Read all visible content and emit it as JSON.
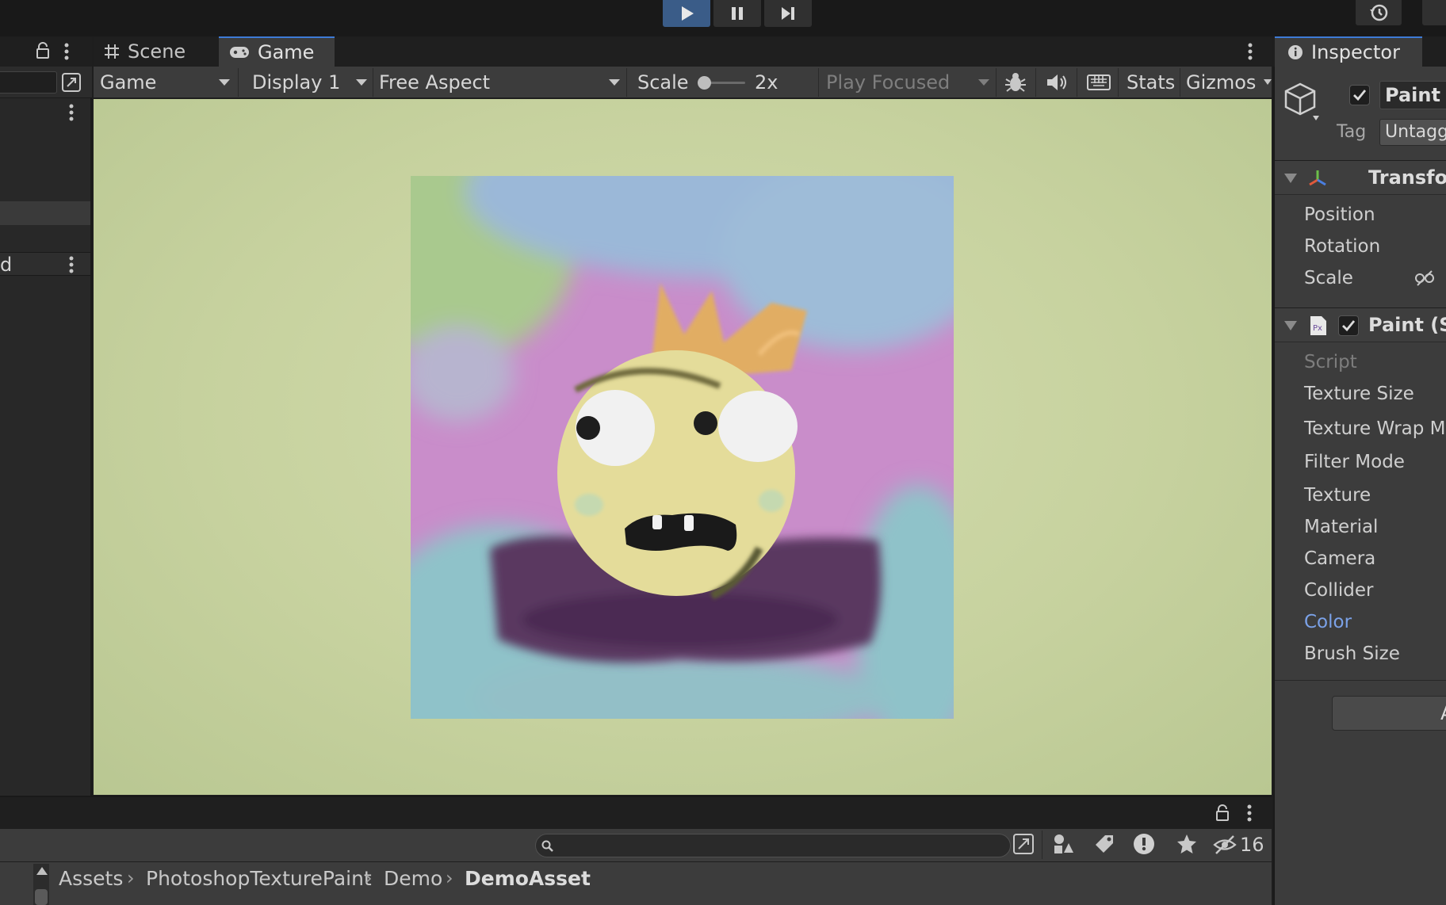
{
  "toolbar": {
    "play_icon": "play-icon",
    "pause_icon": "pause-icon",
    "step_icon": "step-icon",
    "history_icon": "history-icon"
  },
  "game_panel": {
    "tabs": [
      {
        "label": "Scene",
        "icon": "grid-hash-icon"
      },
      {
        "label": "Game",
        "icon": "gamepad-icon"
      }
    ],
    "toolbar": {
      "view_mode": "Game",
      "display": "Display 1",
      "aspect": "Free Aspect",
      "scale_label": "Scale",
      "scale_value": "2x",
      "play_mode": "Play Focused",
      "stats_label": "Stats",
      "gizmos_label": "Gizmos"
    }
  },
  "left_panel": {
    "row_text": "d"
  },
  "inspector": {
    "tab_label": "Inspector",
    "object_name": "Paint",
    "tag_label": "Tag",
    "tag_value": "Untagg",
    "transform": {
      "title": "Transfor",
      "fields": [
        "Position",
        "Rotation",
        "Scale"
      ]
    },
    "paint_component": {
      "title": "Paint (Sc",
      "script_label": "Script",
      "fields": [
        "Texture Size",
        "Texture Wrap M",
        "Filter Mode",
        "Texture",
        "Material",
        "Camera",
        "Collider",
        "Color",
        "Brush Size"
      ]
    },
    "button_text": "A",
    "colors": {
      "accent": "#3e7bd6",
      "link": "#7ba2e8"
    }
  },
  "project_panel": {
    "hidden_count": "16",
    "breadcrumb": [
      "Assets",
      "PhotoshopTexturePaint",
      "Demo",
      "DemoAsset"
    ]
  }
}
